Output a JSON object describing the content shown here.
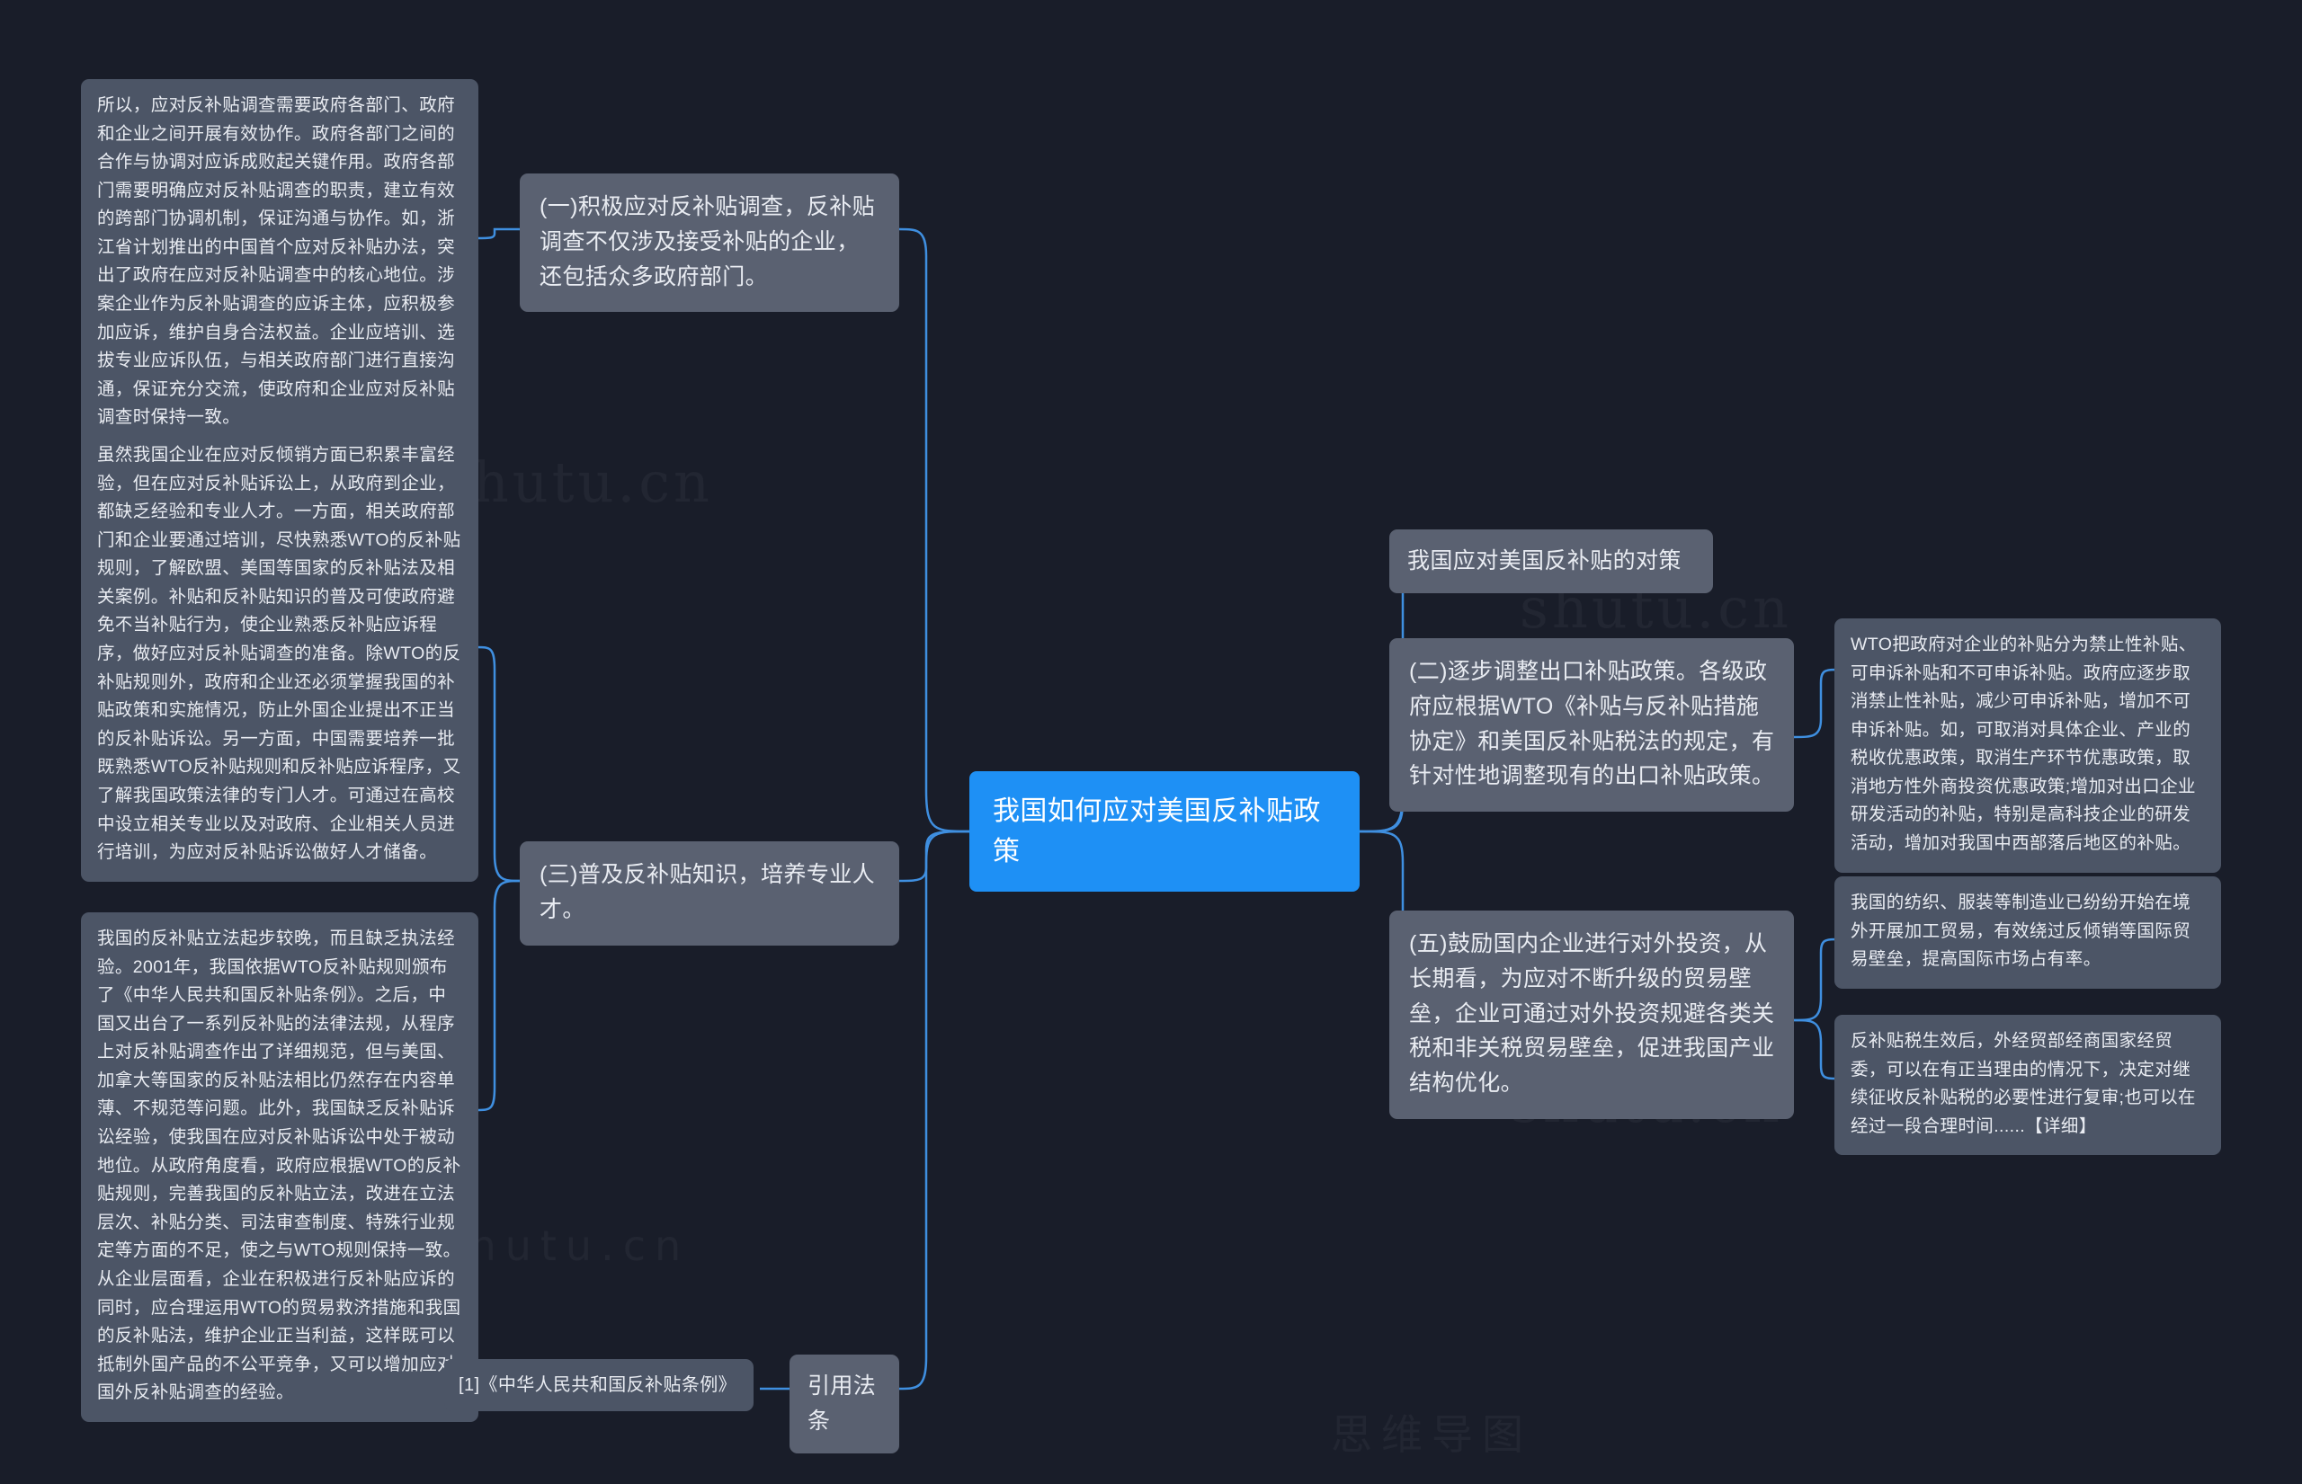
{
  "root": {
    "label": "我国如何应对美国反补贴政策"
  },
  "watermarks": [
    "shutu.cn",
    "shutu.cn",
    "shutu.cn",
    "思维导图 shutu.cn",
    "思维导图"
  ],
  "branches": {
    "b1": "(一)积极应对反补贴调查，反补贴调查不仅涉及接受补贴的企业，还包括众多政府部门。",
    "b3": "(三)普及反补贴知识，培养专业人才。",
    "b_citation": "引用法条",
    "b2_title": "我国应对美国反补贴的对策",
    "b2": "(二)逐步调整出口补贴政策。各级政府应根据WTO《补贴与反补贴措施协定》和美国反补贴税法的规定，有针对性地调整现有的出口补贴政策。",
    "b5": "(五)鼓励国内企业进行对外投资，从长期看，为应对不断升级的贸易壁垒，企业可通过对外投资规避各类关税和非关税贸易壁垒，促进我国产业结构优化。"
  },
  "leaves": {
    "l1": "所以，应对反补贴调查需要政府各部门、政府和企业之间开展有效协作。政府各部门之间的合作与协调对应诉成败起关键作用。政府各部门需要明确应对反补贴调查的职责，建立有效的跨部门协调机制，保证沟通与协作。如，浙江省计划推出的中国首个应对反补贴办法，突出了政府在应对反补贴调查中的核心地位。涉案企业作为反补贴调查的应诉主体，应积极参加应诉，维护自身合法权益。企业应培训、选拔专业应诉队伍，与相关政府部门进行直接沟通，保证充分交流，使政府和企业应对反补贴调查时保持一致。",
    "l2": "虽然我国企业在应对反倾销方面已积累丰富经验，但在应对反补贴诉讼上，从政府到企业，都缺乏经验和专业人才。一方面，相关政府部门和企业要通过培训，尽快熟悉WTO的反补贴规则，了解欧盟、美国等国家的反补贴法及相关案例。补贴和反补贴知识的普及可使政府避免不当补贴行为，使企业熟悉反补贴应诉程序，做好应对反补贴调查的准备。除WTO的反补贴规则外，政府和企业还必须掌握我国的补贴政策和实施情况，防止外国企业提出不正当的反补贴诉讼。另一方面，中国需要培养一批既熟悉WTO反补贴规则和反补贴应诉程序，又了解我国政策法律的专门人才。可通过在高校中设立相关专业以及对政府、企业相关人员进行培训，为应对反补贴诉讼做好人才储备。",
    "l3": "我国的反补贴立法起步较晚，而且缺乏执法经验。2001年，我国依据WTO反补贴规则颁布了《中华人民共和国反补贴条例》。之后，中国又出台了一系列反补贴的法律法规，从程序上对反补贴调查作出了详细规范，但与美国、加拿大等国家的反补贴法相比仍然存在内容单薄、不规范等问题。此外，我国缺乏反补贴诉讼经验，使我国在应对反补贴诉讼中处于被动地位。从政府角度看，政府应根据WTO的反补贴规则，完善我国的反补贴立法，改进在立法层次、补贴分类、司法审查制度、特殊行业规定等方面的不足，使之与WTO规则保持一致。从企业层面看，企业在积极进行反补贴应诉的同时，应合理运用WTO的贸易救济措施和我国的反补贴法，维护企业正当利益，这样既可以抵制外国产品的不公平竞争，又可以增加应对国外反补贴调查的经验。",
    "l4": "WTO把政府对企业的补贴分为禁止性补贴、可申诉补贴和不可申诉补贴。政府应逐步取消禁止性补贴，减少可申诉补贴，增加不可申诉补贴。如，可取消对具体企业、产业的税收优惠政策，取消生产环节优惠政策，取消地方性外商投资优惠政策;增加对出口企业研发活动的补贴，特别是高科技企业的研发活动，增加对我国中西部落后地区的补贴。",
    "l5": "我国的纺织、服装等制造业已纷纷开始在境外开展加工贸易，有效绕过反倾销等国际贸易壁垒，提高国际市场占有率。",
    "l6": "反补贴税生效后，外经贸部经商国家经贸委，可以在有正当理由的情况下，决定对继续征收反补贴税的必要性进行复审;也可以在经过一段合理时间......【详细】",
    "l_cite": "[1]《中华人民共和国反补贴条例》"
  }
}
